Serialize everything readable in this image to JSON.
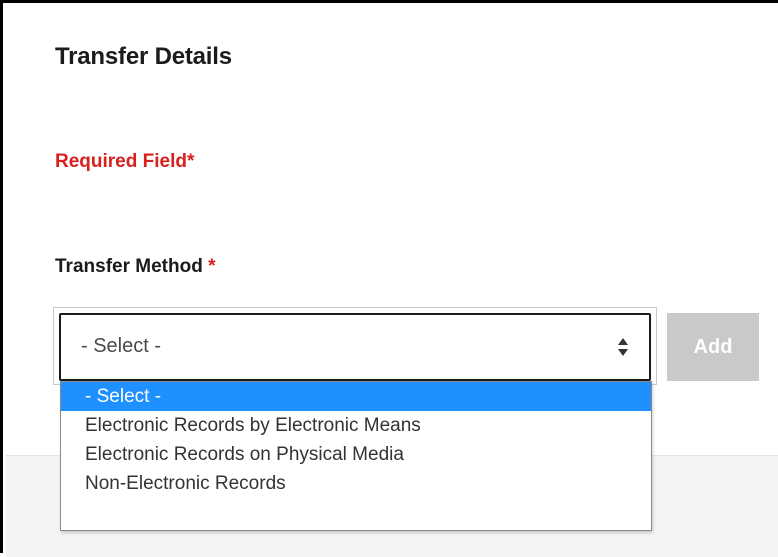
{
  "section": {
    "title": "Transfer Details"
  },
  "required_note": "Required Field*",
  "transfer_method": {
    "label": "Transfer Method",
    "required_mark": "*",
    "selected_value": "- Select -",
    "options": [
      {
        "label": "- Select -",
        "highlighted": true
      },
      {
        "label": "Electronic Records by Electronic Means",
        "highlighted": false
      },
      {
        "label": "Electronic Records on Physical Media",
        "highlighted": false
      },
      {
        "label": "Non-Electronic Records",
        "highlighted": false
      }
    ]
  },
  "add_button": {
    "label": "Add",
    "enabled": false
  },
  "icons": {
    "select_arrow": "up-down-arrow-icon"
  },
  "colors": {
    "required": "#d8201f",
    "highlight": "#1e90ff",
    "button_disabled": "#c9c9c9"
  }
}
